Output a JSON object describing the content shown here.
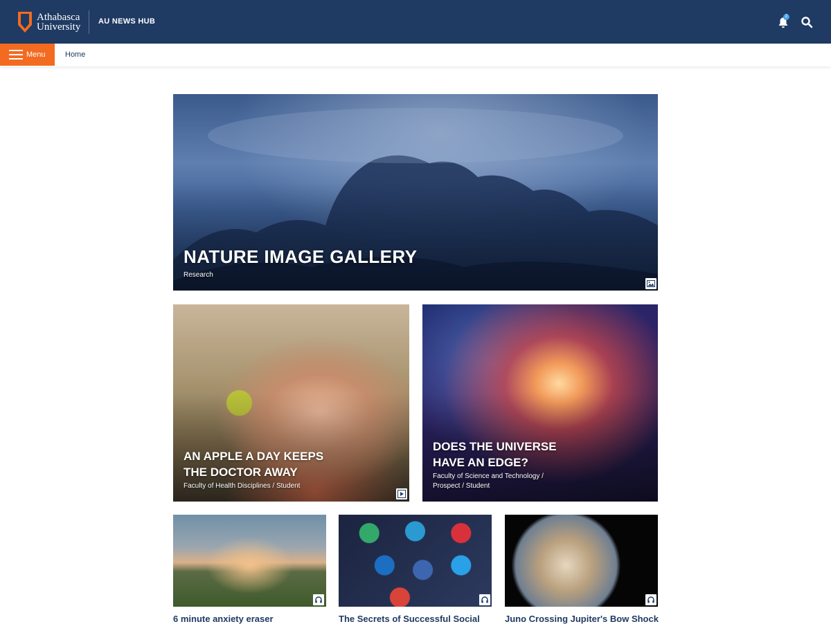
{
  "header": {
    "logo_line1": "Athabasca",
    "logo_line2": "University",
    "hub_title": "AU NEWS HUB",
    "notification_count": "2",
    "bg_color": "#1f3a63",
    "accent_color": "#f26b21"
  },
  "nav": {
    "menu_label": "Menu",
    "breadcrumb": "Home"
  },
  "featured": {
    "title": "NATURE IMAGE GALLERY",
    "category": "Research",
    "media_type": "gallery-icon"
  },
  "cards": [
    {
      "title_line1": "AN APPLE A DAY KEEPS",
      "title_line2": "THE DOCTOR AWAY",
      "category": "Faculty of Health Disciplines / Student",
      "media_type": "play-icon"
    },
    {
      "title_line1": "DOES THE UNIVERSE",
      "title_line2": "HAVE AN EDGE?",
      "category_line1": "Faculty of Science and Technology /",
      "category_line2": "Prospect / Student"
    }
  ],
  "small_cards": [
    {
      "title": "6 minute anxiety eraser",
      "media_type": "headphones-icon"
    },
    {
      "title": "The Secrets of Successful Social",
      "media_type": "headphones-icon"
    },
    {
      "title": "Juno Crossing Jupiter's Bow Shock",
      "media_type": "headphones-icon"
    }
  ]
}
